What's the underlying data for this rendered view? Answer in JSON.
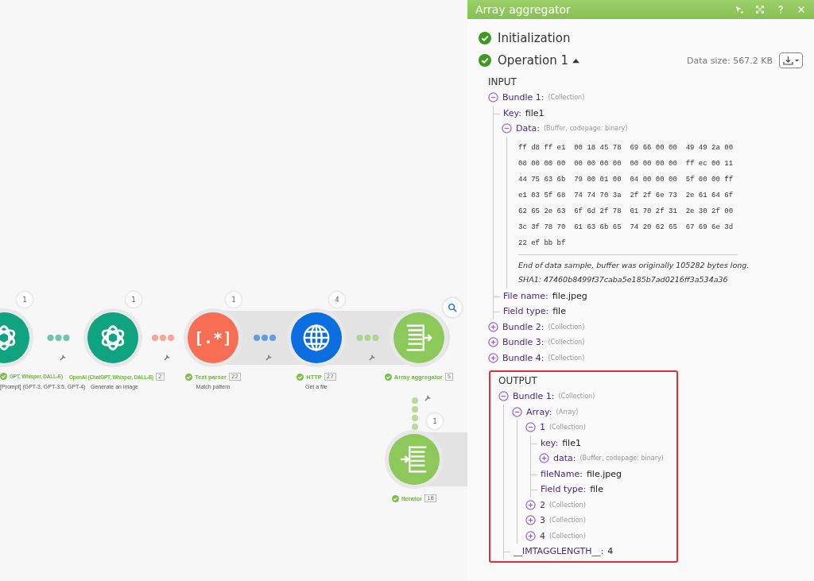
{
  "canvas": {
    "nodes": [
      {
        "label": "GPT, Whisper, DALL-E)",
        "subtitle": "[Prompt] (GPT-3, GPT-3.5, GPT-4)",
        "count": "1",
        "kind": "openai",
        "color": "#10a37f",
        "ok": true
      },
      {
        "label": "OpenAI (ChatGPT, Whisper, DALL-E)",
        "badge": "2",
        "subtitle": "Generate an image",
        "count": "1",
        "kind": "openai",
        "color": "#10a37f",
        "ok": false
      },
      {
        "label": "Text parser",
        "badge": "22",
        "subtitle": "Match pattern",
        "count": "1",
        "kind": "parser",
        "glyph": "[.*]",
        "color": "#f76e54",
        "ok": true
      },
      {
        "label": "HTTP",
        "badge": "27",
        "subtitle": "Get a file",
        "count": "4",
        "kind": "globe",
        "color": "#0a6ee0",
        "ok": true
      },
      {
        "label": "Array aggregator",
        "badge": "5",
        "kind": "aggregator",
        "color": "#8cc85a",
        "ok": true
      },
      {
        "label": "Iterator",
        "badge": "18",
        "count": "1",
        "kind": "iterator",
        "color": "#8cc85a",
        "ok": true
      }
    ]
  },
  "panel": {
    "title": "Array aggregator",
    "initialization": {
      "label": "Initialization",
      "ok": true
    },
    "operation": {
      "label": "Operation 1",
      "ok": true,
      "expanded": true,
      "data_size": "Data size: 567.2 KB"
    },
    "input": {
      "heading": "INPUT",
      "highlighted": false,
      "tree": [
        {
          "kind": "group",
          "label": "Bundle 1:",
          "type": "(Collection)",
          "expanded": true,
          "children": [
            {
              "kind": "field",
              "label": "Key:",
              "value": "file1"
            },
            {
              "kind": "group",
              "label": "Data:",
              "type": "(Buffer, codepage: binary)",
              "expanded": true,
              "children": [
                {
                  "kind": "hex",
                  "rows": [
                    "ff d8 ff e1  00 18 45 78  69 66 00 00  49 49 2a 00",
                    "08 00 00 00  00 00 00 00  00 00 00 00  ff ec 00 11",
                    "44 75 63 6b  79 00 01 00  04 00 00 00  5f 00 00 ff",
                    "e1 03 5f 68  74 74 70 3a  2f 2f 6e 73  2e 61 64 6f",
                    "62 65 2e 63  6f 6d 2f 78  61 70 2f 31  2e 30 2f 00",
                    "3c 3f 78 70  61 63 6b 65  74 20 62 65  67 69 6e 3d",
                    "22 ef bb bf"
                  ],
                  "note": "End of data sample, buffer was originally 105282 bytes long.",
                  "sha": "SHA1: 47460b8499f37caba5e185b7ad0216ff3a534a36"
                }
              ]
            },
            {
              "kind": "field",
              "label": "File name:",
              "value": "file.jpeg"
            },
            {
              "kind": "field",
              "label": "Field type:",
              "value": "file"
            }
          ]
        },
        {
          "kind": "group",
          "label": "Bundle 2:",
          "type": "(Collection)",
          "expanded": false
        },
        {
          "kind": "group",
          "label": "Bundle 3:",
          "type": "(Collection)",
          "expanded": false
        },
        {
          "kind": "group",
          "label": "Bundle 4:",
          "type": "(Collection)",
          "expanded": false
        }
      ]
    },
    "output": {
      "heading": "OUTPUT",
      "highlighted": true,
      "tree": [
        {
          "kind": "group",
          "label": "Bundle 1:",
          "type": "(Collection)",
          "expanded": true,
          "children": [
            {
              "kind": "group",
              "label": "Array:",
              "type": "(Array)",
              "expanded": true,
              "children": [
                {
                  "kind": "group",
                  "label": "1",
                  "type": "(Collection)",
                  "expanded": true,
                  "children": [
                    {
                      "kind": "field",
                      "label": "key:",
                      "value": "file1"
                    },
                    {
                      "kind": "group",
                      "label": "data:",
                      "type": "(Buffer, codepage: binary)",
                      "expanded": false
                    },
                    {
                      "kind": "field",
                      "label": "fileName:",
                      "value": "file.jpeg"
                    },
                    {
                      "kind": "field",
                      "label": "Field type:",
                      "value": "file"
                    }
                  ]
                },
                {
                  "kind": "group",
                  "label": "2",
                  "type": "(Collection)",
                  "expanded": false
                },
                {
                  "kind": "group",
                  "label": "3",
                  "type": "(Collection)",
                  "expanded": false
                },
                {
                  "kind": "group",
                  "label": "4",
                  "type": "(Collection)",
                  "expanded": false
                }
              ]
            },
            {
              "kind": "field",
              "label": "__IMTAGGLENGTH__:",
              "value": "4"
            }
          ]
        }
      ]
    }
  }
}
